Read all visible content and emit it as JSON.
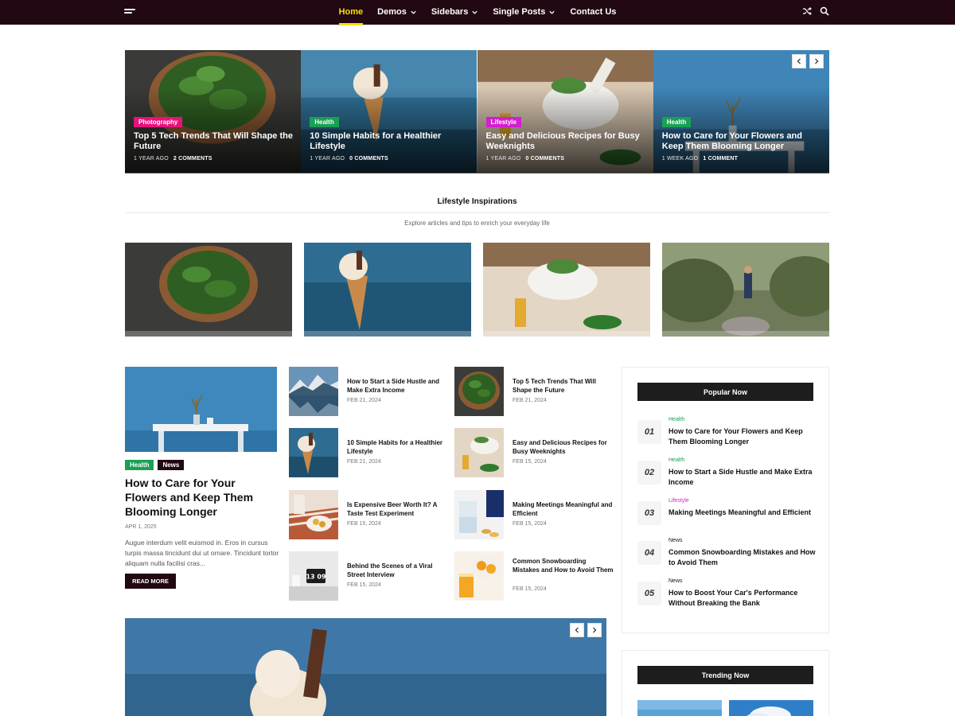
{
  "nav": {
    "items": [
      {
        "label": "Home",
        "has_dropdown": false,
        "active": true
      },
      {
        "label": "Demos",
        "has_dropdown": true,
        "active": false
      },
      {
        "label": "Sidebars",
        "has_dropdown": true,
        "active": false
      },
      {
        "label": "Single Posts",
        "has_dropdown": true,
        "active": false
      },
      {
        "label": "Contact Us",
        "has_dropdown": false,
        "active": false
      }
    ],
    "icons": [
      "menu-icon",
      "shuffle-icon",
      "search-icon"
    ],
    "colors": {
      "bar": "#220812",
      "active": "#ffe000"
    }
  },
  "hero": {
    "slides": [
      {
        "category": "Photography",
        "category_color": "#e6127a",
        "title": "Top 5 Tech Trends That Will Shape the Future",
        "age": "1 YEAR AGO",
        "comments": "2 COMMENTS"
      },
      {
        "category": "Health",
        "category_color": "#19a055",
        "title": "10 Simple Habits for a Healthier Lifestyle",
        "age": "1 YEAR AGO",
        "comments": "0 COMMENTS"
      },
      {
        "category": "Lifestyle",
        "category_color": "#d21fd0",
        "title": "Easy and Delicious Recipes for Busy Weeknights",
        "age": "1 YEAR AGO",
        "comments": "0 COMMENTS"
      },
      {
        "category": "Health",
        "category_color": "#19a055",
        "title": "How to Care for Your Flowers and Keep Them Blooming Longer",
        "age": "1 WEEK AGO",
        "comments": "1 COMMENT"
      }
    ]
  },
  "section": {
    "title": "Lifestyle Inspirations",
    "subtitle": "Explore articles and tips to enrich your everyday life"
  },
  "featured": {
    "tags": [
      {
        "label": "Health",
        "color": "#19a055"
      },
      {
        "label": "News",
        "color": "#220812"
      }
    ],
    "title": "How to Care for Your Flowers and Keep Them Blooming Longer",
    "date": "APR 1, 2025",
    "excerpt": "Augue interdum velit euismod in. Eros in cursus turpis massa tincidunt dui ut ornare. Tincidunt tortor aliquam nulla facilisi cras...",
    "read_more": "READ MORE"
  },
  "list_a": [
    {
      "title": "How to Start a Side Hustle and Make Extra Income",
      "date": "FEB 21, 2024"
    },
    {
      "title": "10 Simple Habits for a Healthier Lifestyle",
      "date": "FEB 21, 2024"
    },
    {
      "title": "Is Expensive Beer Worth It? A Taste Test Experiment",
      "date": "FEB 15, 2024"
    },
    {
      "title": "Behind the Scenes of a Viral Street Interview",
      "date": "FEB 15, 2024",
      "clock": "13 09"
    }
  ],
  "list_b": [
    {
      "title": "Top 5 Tech Trends That Will Shape the Future",
      "date": "FEB 21, 2024"
    },
    {
      "title": "Easy and Delicious Recipes for Busy Weeknights",
      "date": "FEB 15, 2024"
    },
    {
      "title": "Making Meetings Meaningful and Efficient",
      "date": "FEB 15, 2024"
    },
    {
      "title": "Common Snowboarding Mistakes and How to Avoid Them",
      "date": "FEB 15, 2024"
    }
  ],
  "popular": {
    "heading": "Popular Now",
    "items": [
      {
        "num": "01",
        "category": "Health",
        "category_color": "#19a055",
        "title": "How to Care for Your Flowers and Keep Them Blooming Longer"
      },
      {
        "num": "02",
        "category": "Health",
        "category_color": "#19a055",
        "title": "How to Start a Side Hustle and Make Extra Income"
      },
      {
        "num": "03",
        "category": "Lifestyle",
        "category_color": "#d21fd0",
        "title": "Making Meetings Meaningful and Efficient"
      },
      {
        "num": "04",
        "category": "News",
        "category_color": "#111111",
        "title": "Common Snowboarding Mistakes and How to Avoid Them"
      },
      {
        "num": "05",
        "category": "News",
        "category_color": "#111111",
        "title": "How to Boost Your Car's Performance Without Breaking the Bank"
      }
    ]
  },
  "trending": {
    "heading": "Trending Now"
  }
}
